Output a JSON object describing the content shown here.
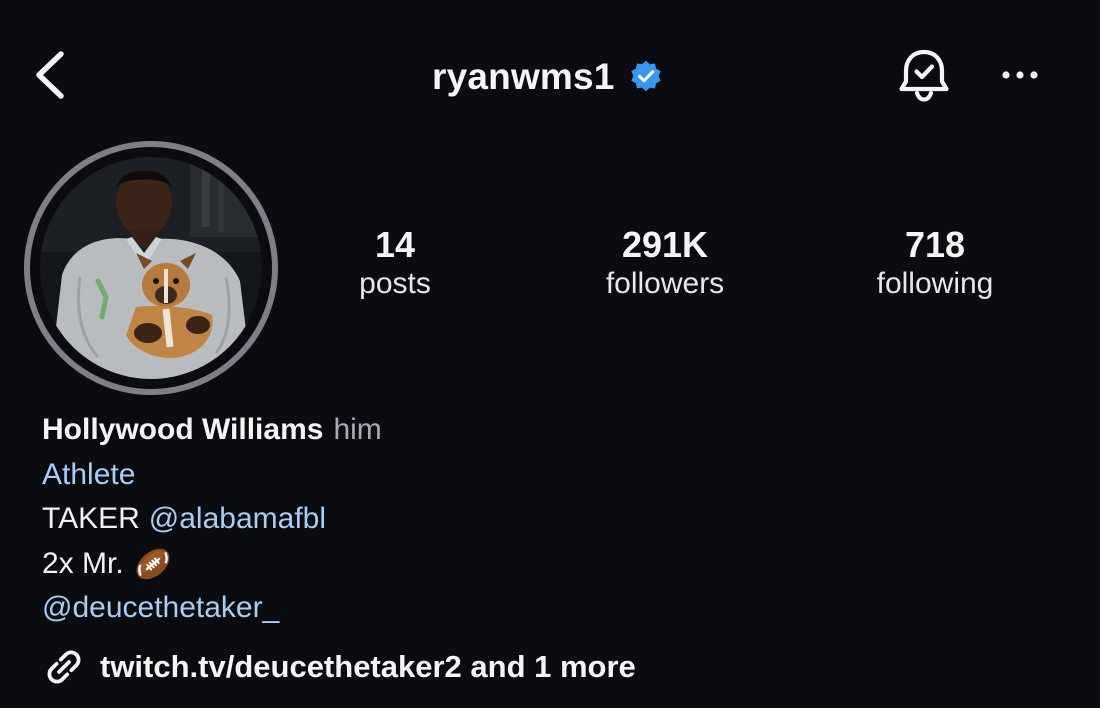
{
  "header": {
    "username": "ryanwms1",
    "verified_icon": "verified-badge-icon",
    "back_icon": "chevron-left-icon",
    "notification_icon": "bell-check-icon",
    "more_icon": "more-horizontal-icon",
    "verified_color": "#3897f0"
  },
  "profile": {
    "avatar_icon": "profile-photo",
    "stats": {
      "posts": {
        "value": "14",
        "label": "posts"
      },
      "followers": {
        "value": "291K",
        "label": "followers"
      },
      "following": {
        "value": "718",
        "label": "following"
      }
    }
  },
  "bio": {
    "name": "Hollywood Williams",
    "pronouns": "him",
    "category": "Athlete",
    "line_taker": "TAKER",
    "mention_one": "@alabamafbl",
    "line_mr": "2x Mr.",
    "emoji_icon": "american-football-icon",
    "mention_two": "@deucethetaker_",
    "link_icon": "link-icon",
    "link_text": "twitch.tv/deucethetaker2 and 1 more",
    "link_color": "#a9cdf3"
  }
}
